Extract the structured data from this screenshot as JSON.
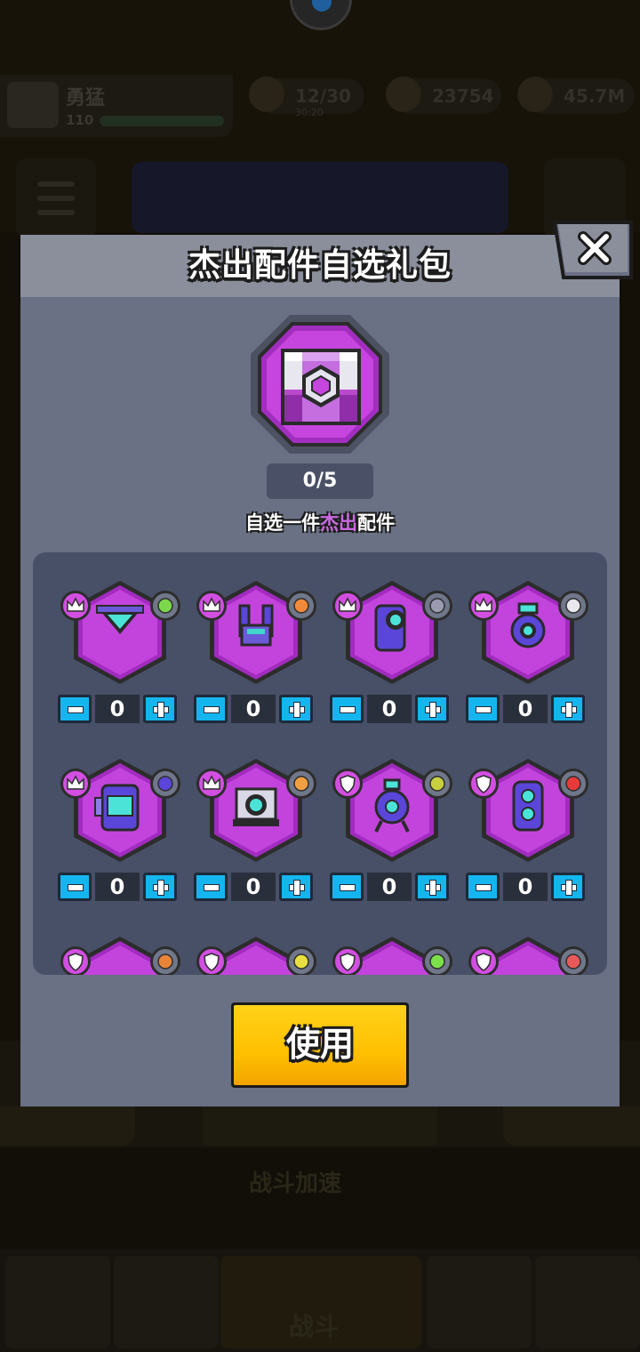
{
  "dialog": {
    "title": "杰出配件自选礼包",
    "counter": "0/5",
    "subtitle_before": "自选一件",
    "subtitle_highlight": "杰出",
    "subtitle_after": "配件",
    "use_button": "使用",
    "close_icon": "close-x-icon"
  },
  "items": [
    {
      "qty": "0",
      "rarity": "crown",
      "type_icon": "bottle-icon"
    },
    {
      "qty": "0",
      "rarity": "crown",
      "type_icon": "bag-icon"
    },
    {
      "qty": "0",
      "rarity": "crown",
      "type_icon": "radio-icon"
    },
    {
      "qty": "0",
      "rarity": "crown",
      "type_icon": "ball-icon"
    },
    {
      "qty": "0",
      "rarity": "crown",
      "type_icon": "cone-icon"
    },
    {
      "qty": "0",
      "rarity": "crown",
      "type_icon": "croissant-icon"
    },
    {
      "qty": "0",
      "rarity": "shield",
      "type_icon": "virus-icon"
    },
    {
      "qty": "0",
      "rarity": "shield",
      "type_icon": "boomerang-icon"
    },
    {
      "qty": "",
      "rarity": "shield",
      "type_icon": "brick-icon"
    },
    {
      "qty": "",
      "rarity": "shield",
      "type_icon": "target-icon"
    },
    {
      "qty": "",
      "rarity": "shield",
      "type_icon": "plant-icon"
    },
    {
      "qty": "",
      "rarity": "shield",
      "type_icon": "rocket-icon"
    }
  ],
  "colors": {
    "rarity_purple": "#d24fe2",
    "stepper_blue": "#15b6ef",
    "use_yellow": "#ffc000",
    "highlight": "#c96ae0"
  }
}
